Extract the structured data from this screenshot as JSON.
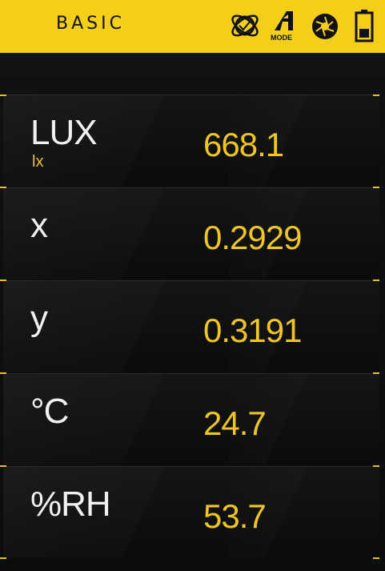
{
  "header": {
    "title": "BASIC",
    "icons": [
      "target-orbit-icon",
      "mode-icon",
      "aperture-icon",
      "battery-icon"
    ],
    "mode_label": "MODE"
  },
  "readings": [
    {
      "label": "LUX",
      "unit": "lx",
      "value": "668.1"
    },
    {
      "label": "x",
      "unit": "",
      "value": "0.2929"
    },
    {
      "label": "y",
      "unit": "",
      "value": "0.3191"
    },
    {
      "label": "°C",
      "unit": "",
      "value": "24.7"
    },
    {
      "label": "%RH",
      "unit": "",
      "value": "53.7"
    }
  ],
  "colors": {
    "accent": "#f4cf1a",
    "value_text": "#f0c520",
    "label_text": "#f1f1f1",
    "background": "#0d0e0e"
  }
}
